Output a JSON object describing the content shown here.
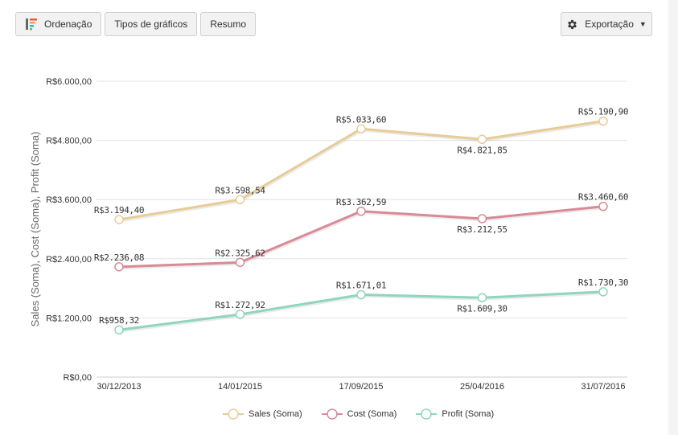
{
  "toolbar": {
    "ordenacao_label": "Ordenação",
    "tipos_label": "Tipos de gráficos",
    "resumo_label": "Resumo",
    "export_label": "Exportação"
  },
  "colors": {
    "sales": "#e8cc98",
    "cost": "#d98a96",
    "profit": "#8fd6bd",
    "grid": "#e3e3e3",
    "text": "#333333"
  },
  "chart_data": {
    "type": "line",
    "ylabel": "Sales (Soma), Cost (Soma), Profit (Soma)",
    "xlabel": "",
    "categories": [
      "30/12/2013",
      "14/01/2015",
      "17/09/2015",
      "25/04/2016",
      "31/07/2016"
    ],
    "ylim": [
      0,
      6000
    ],
    "yticks": [
      0,
      1200,
      2400,
      3600,
      4800,
      6000
    ],
    "ytick_labels": [
      "R$0,00",
      "R$1.200,00",
      "R$2.400,00",
      "R$3.600,00",
      "R$4.800,00",
      "R$6.000,00"
    ],
    "grid": true,
    "legend_position": "bottom",
    "series": [
      {
        "name": "Sales (Soma)",
        "color_key": "sales",
        "values": [
          3194.4,
          3598.54,
          5033.6,
          4821.85,
          5190.9
        ],
        "labels": [
          "R$3.194,40",
          "R$3.598,54",
          "R$5.033,60",
          "R$4.821,85",
          "R$5.190,90"
        ],
        "label_pos": [
          "above",
          "above",
          "above",
          "below",
          "above"
        ]
      },
      {
        "name": "Cost (Soma)",
        "color_key": "cost",
        "values": [
          2236.08,
          2325.62,
          3362.59,
          3212.55,
          3460.6
        ],
        "labels": [
          "R$2.236,08",
          "R$2.325,62",
          "R$3.362,59",
          "R$3.212,55",
          "R$3.460,60"
        ],
        "label_pos": [
          "above",
          "above",
          "above",
          "below",
          "above"
        ]
      },
      {
        "name": "Profit (Soma)",
        "color_key": "profit",
        "values": [
          958.32,
          1272.92,
          1671.01,
          1609.3,
          1730.3
        ],
        "labels": [
          "R$958,32",
          "R$1.272,92",
          "R$1.671,01",
          "R$1.609,30",
          "R$1.730,30"
        ],
        "label_pos": [
          "above",
          "above",
          "above",
          "below",
          "above"
        ]
      }
    ]
  }
}
